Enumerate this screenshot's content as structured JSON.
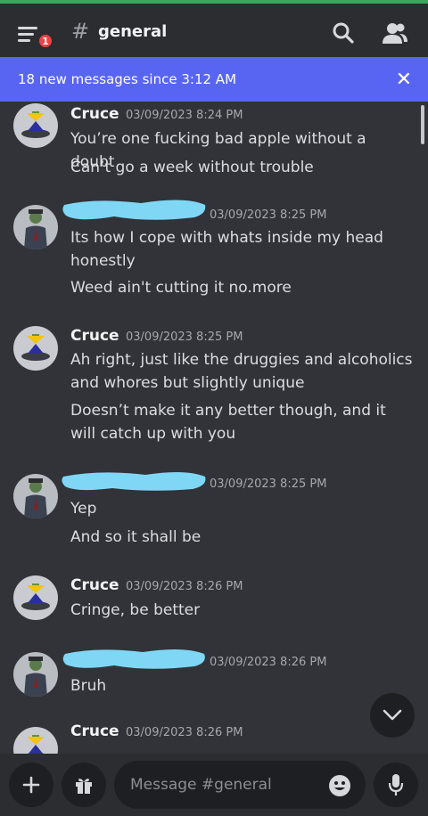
{
  "header": {
    "unread_badge": "1",
    "hash": "#",
    "channel": "general",
    "icons": [
      "menu-icon",
      "search-icon",
      "members-icon"
    ]
  },
  "banner": {
    "text": "18 new messages since 3:12 AM",
    "close": "✕"
  },
  "messages": [
    {
      "author": "Cruce",
      "time": "03/09/2023 8:24 PM",
      "lines": [
        "You’re one fucking bad apple without a doubt",
        "Can’t go a week without trouble"
      ]
    },
    {
      "author": "",
      "time": "03/09/2023 8:25 PM",
      "lines": [
        "Its how I cope with whats inside my head honestly",
        "Weed ain't cutting it no.more"
      ]
    },
    {
      "author": "Cruce",
      "time": "03/09/2023 8:25 PM",
      "lines": [
        "Ah right, just like the druggies and alcoholics and whores but slightly unique",
        "Doesn’t make it any better though, and it will catch up with you"
      ]
    },
    {
      "author": "",
      "time": "03/09/2023 8:25 PM",
      "lines": [
        "Yep",
        "And so it shall be"
      ]
    },
    {
      "author": "Cruce",
      "time": "03/09/2023 8:26 PM",
      "lines": [
        "Cringe, be better"
      ]
    },
    {
      "author": "",
      "time": "03/09/2023 8:26 PM",
      "lines": [
        "Bruh"
      ]
    },
    {
      "author": "Cruce",
      "time": "03/09/2023 8:26 PM",
      "lines": []
    }
  ],
  "composer": {
    "placeholder": "Message #general",
    "icons": [
      "plus-icon",
      "gift-icon",
      "emoji-icon",
      "mic-icon"
    ]
  },
  "colors": {
    "background": "#313338",
    "header": "#2b2d31",
    "banner": "#5865f2",
    "redaction": "#7fd7f5",
    "badge": "#f23f43"
  }
}
